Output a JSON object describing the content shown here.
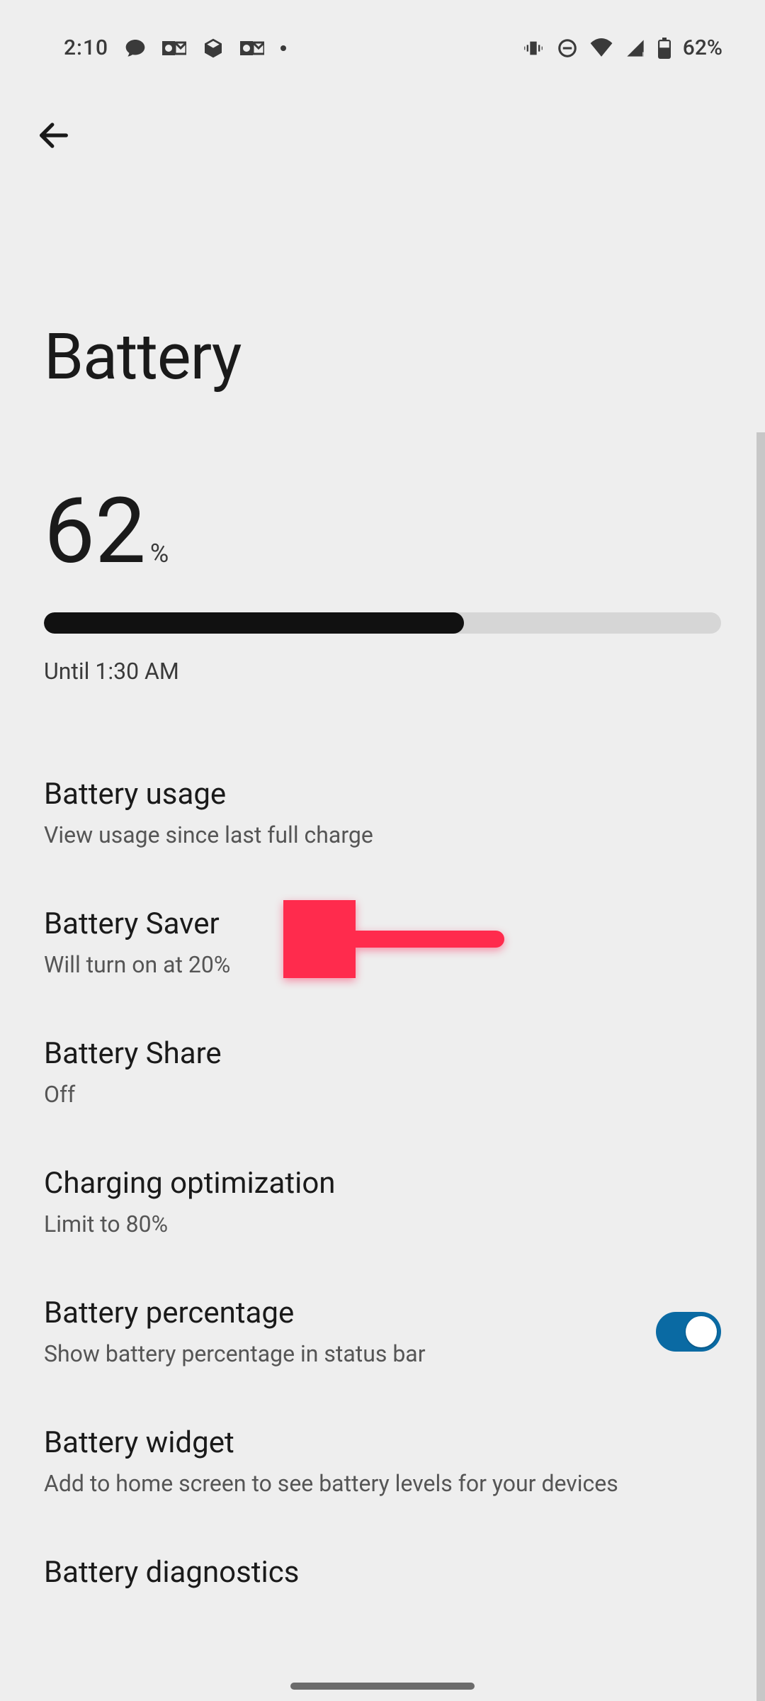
{
  "status": {
    "time": "2:10",
    "battery_text": "62%"
  },
  "page": {
    "title": "Battery"
  },
  "battery": {
    "percent": "62",
    "unit": "%",
    "fill_percent": 62,
    "until": "Until 1:30 AM"
  },
  "items": {
    "usage": {
      "title": "Battery usage",
      "sub": "View usage since last full charge"
    },
    "saver": {
      "title": "Battery Saver",
      "sub": "Will turn on at 20%"
    },
    "share": {
      "title": "Battery Share",
      "sub": "Off"
    },
    "charging_opt": {
      "title": "Charging optimization",
      "sub": "Limit to 80%"
    },
    "percentage": {
      "title": "Battery percentage",
      "sub": "Show battery percentage in status bar",
      "toggle": true
    },
    "widget": {
      "title": "Battery widget",
      "sub": "Add to home screen to see battery levels for your devices"
    },
    "diagnostics": {
      "title": "Battery diagnostics"
    }
  },
  "colors": {
    "accent": "#0a6aa3",
    "annotation": "#ff2b4d"
  }
}
